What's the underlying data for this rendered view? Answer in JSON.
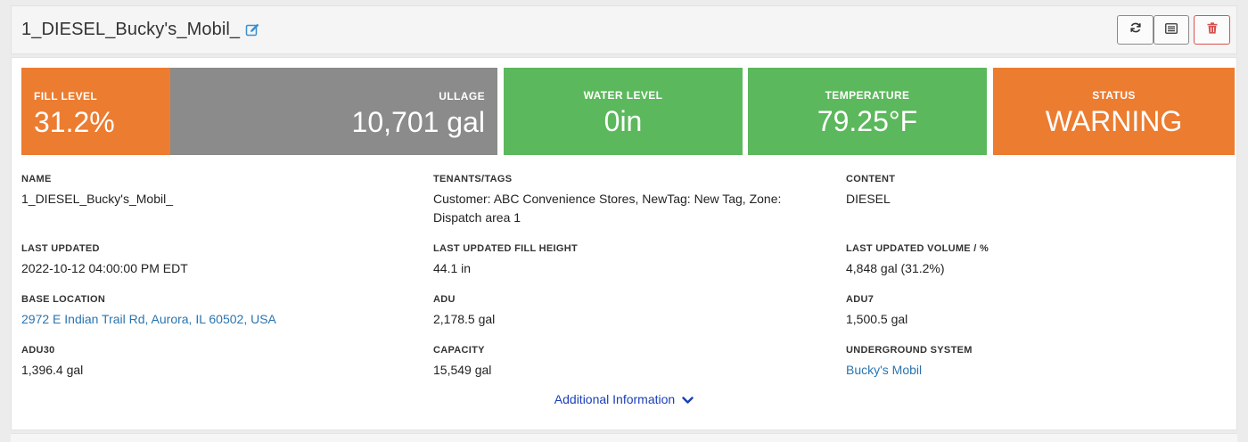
{
  "header": {
    "title": "1_DIESEL_Bucky's_Mobil_"
  },
  "tiles": {
    "fill_level": {
      "label": "FILL LEVEL",
      "value": "31.2%",
      "fraction": 0.312,
      "color": "#ec7c30"
    },
    "ullage": {
      "label": "ULLAGE",
      "value": "10,701 gal",
      "color": "#8b8b8b"
    },
    "water_level": {
      "label": "WATER LEVEL",
      "value": "0in",
      "color": "#5cb85c"
    },
    "temperature": {
      "label": "TEMPERATURE",
      "value": "79.25°F",
      "color": "#5cb85c"
    },
    "status": {
      "label": "STATUS",
      "value": "WARNING",
      "color": "#ec7c30"
    }
  },
  "details": {
    "name": {
      "label": "NAME",
      "value": "1_DIESEL_Bucky's_Mobil_"
    },
    "tenants": {
      "label": "TENANTS/TAGS",
      "value": "Customer: ABC Convenience Stores, NewTag: New Tag, Zone: Dispatch area 1"
    },
    "content": {
      "label": "CONTENT",
      "value": "DIESEL"
    },
    "last_updated": {
      "label": "LAST UPDATED",
      "value": "2022-10-12 04:00:00 PM EDT"
    },
    "last_fill_height": {
      "label": "LAST UPDATED FILL HEIGHT",
      "value": "44.1 in"
    },
    "last_volume": {
      "label": "LAST UPDATED VOLUME / %",
      "value": "4,848 gal (31.2%)"
    },
    "base_location": {
      "label": "BASE LOCATION",
      "value": "2972 E Indian Trail Rd, Aurora, IL 60502, USA"
    },
    "adu": {
      "label": "ADU",
      "value": "2,178.5 gal"
    },
    "adu7": {
      "label": "ADU7",
      "value": "1,500.5 gal"
    },
    "adu30": {
      "label": "ADU30",
      "value": "1,396.4 gal"
    },
    "capacity": {
      "label": "CAPACITY",
      "value": "15,549 gal"
    },
    "underground_system": {
      "label": "UNDERGROUND SYSTEM",
      "value": "Bucky's Mobil"
    }
  },
  "additional_info": {
    "label": "Additional Information"
  },
  "icons": {
    "edit": "edit-icon",
    "refresh": "refresh-icon",
    "list": "list-icon",
    "delete": "trash-icon",
    "expand": "chevron-down-icon"
  },
  "colors": {
    "link": "#2a74b0",
    "danger": "#d9534f",
    "more_link": "#1a3fb5"
  }
}
